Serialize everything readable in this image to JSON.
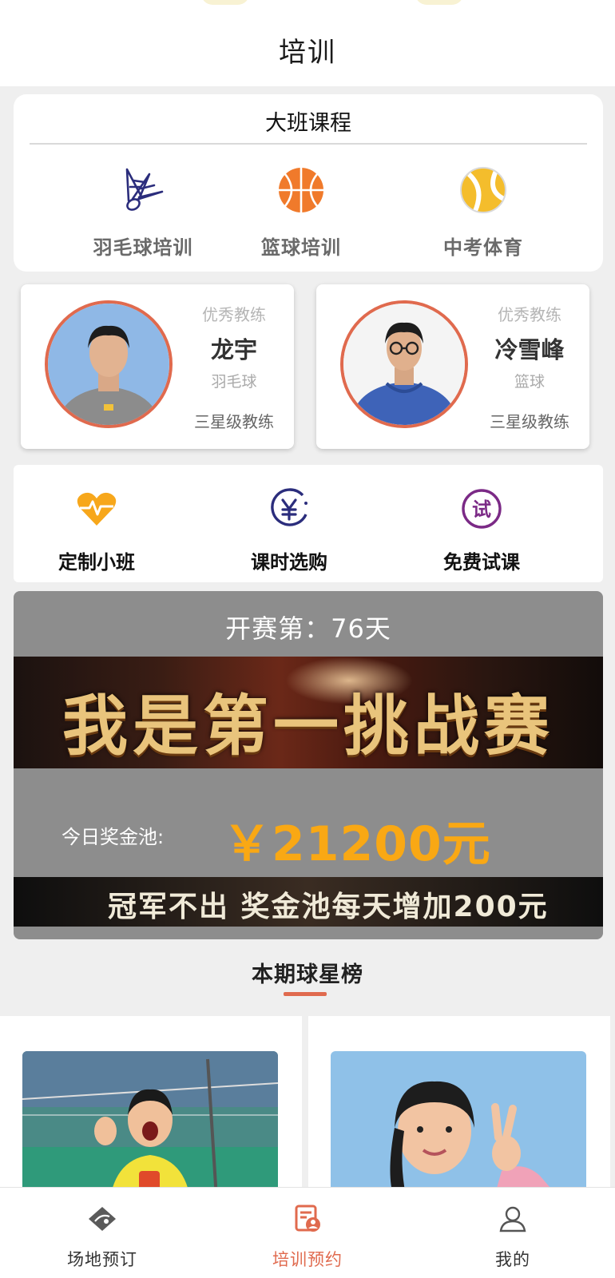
{
  "header": {
    "title": "培训"
  },
  "class_section": {
    "title": "大班课程",
    "courses": [
      {
        "label": "羽毛球培训",
        "icon": "shuttlecock-icon"
      },
      {
        "label": "篮球培训",
        "icon": "basketball-icon"
      },
      {
        "label": "中考体育",
        "icon": "tennis-ball-icon"
      }
    ]
  },
  "coaches": [
    {
      "tag": "优秀教练",
      "name": "龙宇",
      "sport": "羽毛球",
      "level": "三星级教练"
    },
    {
      "tag": "优秀教练",
      "name": "冷雪峰",
      "sport": "篮球",
      "level": "三星级教练"
    }
  ],
  "services": [
    {
      "label": "定制小班",
      "icon": "heartbeat-icon"
    },
    {
      "label": "课时选购",
      "icon": "yuan-icon"
    },
    {
      "label": "免费试课",
      "icon": "trial-icon",
      "icon_text": "试"
    }
  ],
  "match": {
    "countdown": "开赛第：76天",
    "banner_title": "我是第一挑战赛",
    "pool_label": "今日奖金池:",
    "pool_value": "￥21200元",
    "banner_subtitle": "冠军不出 奖金池每天增加200元"
  },
  "stars_section": {
    "title": "本期球星榜"
  },
  "tabbar": {
    "items": [
      {
        "label": "场地预订",
        "icon": "venue-icon",
        "active": false
      },
      {
        "label": "培训预约",
        "icon": "training-icon",
        "active": true
      },
      {
        "label": "我的",
        "icon": "user-icon",
        "active": false
      }
    ]
  },
  "colors": {
    "accent": "#e06a4e",
    "prize": "#f9a814",
    "match_bg": "#8d8d8d",
    "service_yellow": "#f7a71b",
    "service_navy": "#2b2d7c",
    "service_purple": "#7b2a86"
  }
}
